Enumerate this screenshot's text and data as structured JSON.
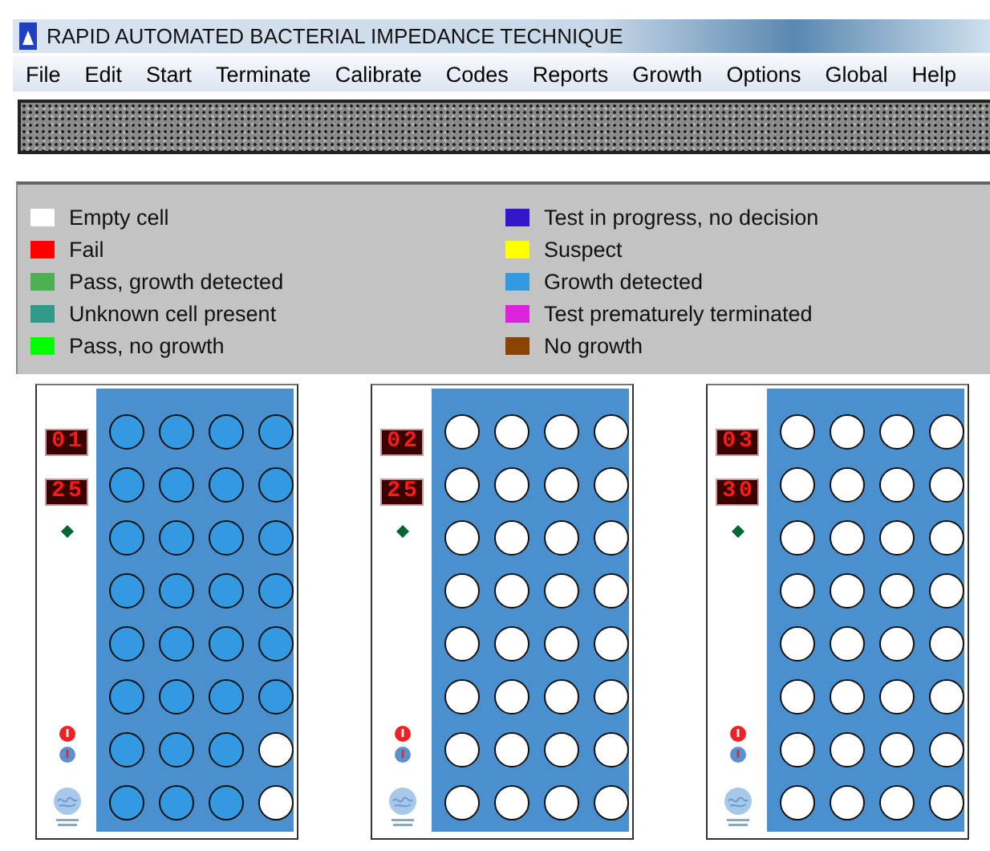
{
  "window": {
    "title": "RAPID AUTOMATED BACTERIAL IMPEDANCE TECHNIQUE"
  },
  "menu": [
    "File",
    "Edit",
    "Start",
    "Terminate",
    "Calibrate",
    "Codes",
    "Reports",
    "Growth",
    "Options",
    "Global",
    "Help"
  ],
  "legend": [
    {
      "label": "Empty cell",
      "color": "#ffffff"
    },
    {
      "label": "Fail",
      "color": "#ff0000"
    },
    {
      "label": "Pass, growth detected",
      "color": "#4cb050"
    },
    {
      "label": "Unknown cell present",
      "color": "#2f9a88"
    },
    {
      "label": "Pass, no growth",
      "color": "#00ff00"
    },
    {
      "label": "Test in progress, no decision",
      "color": "#3316cc"
    },
    {
      "label": "Suspect",
      "color": "#ffff00"
    },
    {
      "label": "Growth detected",
      "color": "#3399e0"
    },
    {
      "label": "Test prematurely terminated",
      "color": "#dd22dd"
    },
    {
      "label": "No growth",
      "color": "#8a4400"
    }
  ],
  "panels": [
    {
      "module": "01",
      "time": "25",
      "cells": [
        [
          {
            "color": "#3399e0"
          },
          {
            "color": "#3399e0"
          },
          {
            "color": "#3399e0"
          },
          {
            "color": "#3399e0"
          }
        ],
        [
          {
            "color": "#3399e0"
          },
          {
            "color": "#3399e0"
          },
          {
            "color": "#3399e0"
          },
          {
            "color": "#3399e0"
          }
        ],
        [
          {
            "color": "#3399e0"
          },
          {
            "color": "#3399e0"
          },
          {
            "color": "#3399e0"
          },
          {
            "color": "#3399e0"
          }
        ],
        [
          {
            "color": "#3399e0"
          },
          {
            "color": "#3399e0"
          },
          {
            "color": "#3399e0"
          },
          {
            "color": "#3399e0"
          }
        ],
        [
          {
            "color": "#3399e0"
          },
          {
            "color": "#3399e0"
          },
          {
            "color": "#3399e0"
          },
          {
            "color": "#3399e0"
          }
        ],
        [
          {
            "color": "#3399e0"
          },
          {
            "color": "#3399e0"
          },
          {
            "color": "#3399e0"
          },
          {
            "color": "#3399e0"
          }
        ],
        [
          {
            "color": "#3399e0"
          },
          {
            "color": "#3399e0"
          },
          {
            "color": "#3399e0"
          },
          {
            "color": "#ffffff"
          }
        ],
        [
          {
            "color": "#3399e0"
          },
          {
            "color": "#3399e0"
          },
          {
            "color": "#3399e0"
          },
          {
            "color": "#ffffff"
          }
        ]
      ]
    },
    {
      "module": "02",
      "time": "25",
      "cells": [
        [
          {
            "color": "#ffffff"
          },
          {
            "color": "#ffffff"
          },
          {
            "color": "#ffffff"
          },
          {
            "color": "#ffffff"
          }
        ],
        [
          {
            "color": "#ffffff"
          },
          {
            "color": "#ffffff"
          },
          {
            "color": "#ffffff"
          },
          {
            "color": "#ffffff"
          }
        ],
        [
          {
            "color": "#ffffff"
          },
          {
            "color": "#ffffff"
          },
          {
            "color": "#ffffff"
          },
          {
            "color": "#ffffff"
          }
        ],
        [
          {
            "color": "#ffffff"
          },
          {
            "color": "#ffffff"
          },
          {
            "color": "#ffffff"
          },
          {
            "color": "#ffffff"
          }
        ],
        [
          {
            "color": "#ffffff"
          },
          {
            "color": "#ffffff"
          },
          {
            "color": "#ffffff"
          },
          {
            "color": "#ffffff"
          }
        ],
        [
          {
            "color": "#ffffff"
          },
          {
            "color": "#ffffff"
          },
          {
            "color": "#ffffff"
          },
          {
            "color": "#ffffff"
          }
        ],
        [
          {
            "color": "#ffffff"
          },
          {
            "color": "#ffffff"
          },
          {
            "color": "#ffffff"
          },
          {
            "color": "#ffffff"
          }
        ],
        [
          {
            "color": "#ffffff"
          },
          {
            "color": "#ffffff"
          },
          {
            "color": "#ffffff"
          },
          {
            "color": "#ffffff"
          }
        ]
      ]
    },
    {
      "module": "03",
      "time": "30",
      "cells": [
        [
          {
            "color": "#ffffff"
          },
          {
            "color": "#ffffff"
          },
          {
            "color": "#ffffff"
          },
          {
            "color": "#ffffff"
          }
        ],
        [
          {
            "color": "#ffffff"
          },
          {
            "color": "#ffffff"
          },
          {
            "color": "#ffffff"
          },
          {
            "color": "#ffffff"
          }
        ],
        [
          {
            "color": "#ffffff"
          },
          {
            "color": "#ffffff"
          },
          {
            "color": "#ffffff"
          },
          {
            "color": "#ffffff"
          }
        ],
        [
          {
            "color": "#ffffff"
          },
          {
            "color": "#ffffff"
          },
          {
            "color": "#ffffff"
          },
          {
            "color": "#ffffff"
          }
        ],
        [
          {
            "color": "#ffffff"
          },
          {
            "color": "#ffffff"
          },
          {
            "color": "#ffffff"
          },
          {
            "color": "#ffffff"
          }
        ],
        [
          {
            "color": "#ffffff"
          },
          {
            "color": "#ffffff"
          },
          {
            "color": "#ffffff"
          },
          {
            "color": "#ffffff"
          }
        ],
        [
          {
            "color": "#ffffff"
          },
          {
            "color": "#ffffff"
          },
          {
            "color": "#ffffff"
          },
          {
            "color": "#ffffff"
          }
        ],
        [
          {
            "color": "#ffffff"
          },
          {
            "color": "#ffffff"
          },
          {
            "color": "#ffffff"
          },
          {
            "color": "#ffffff"
          }
        ]
      ]
    }
  ]
}
